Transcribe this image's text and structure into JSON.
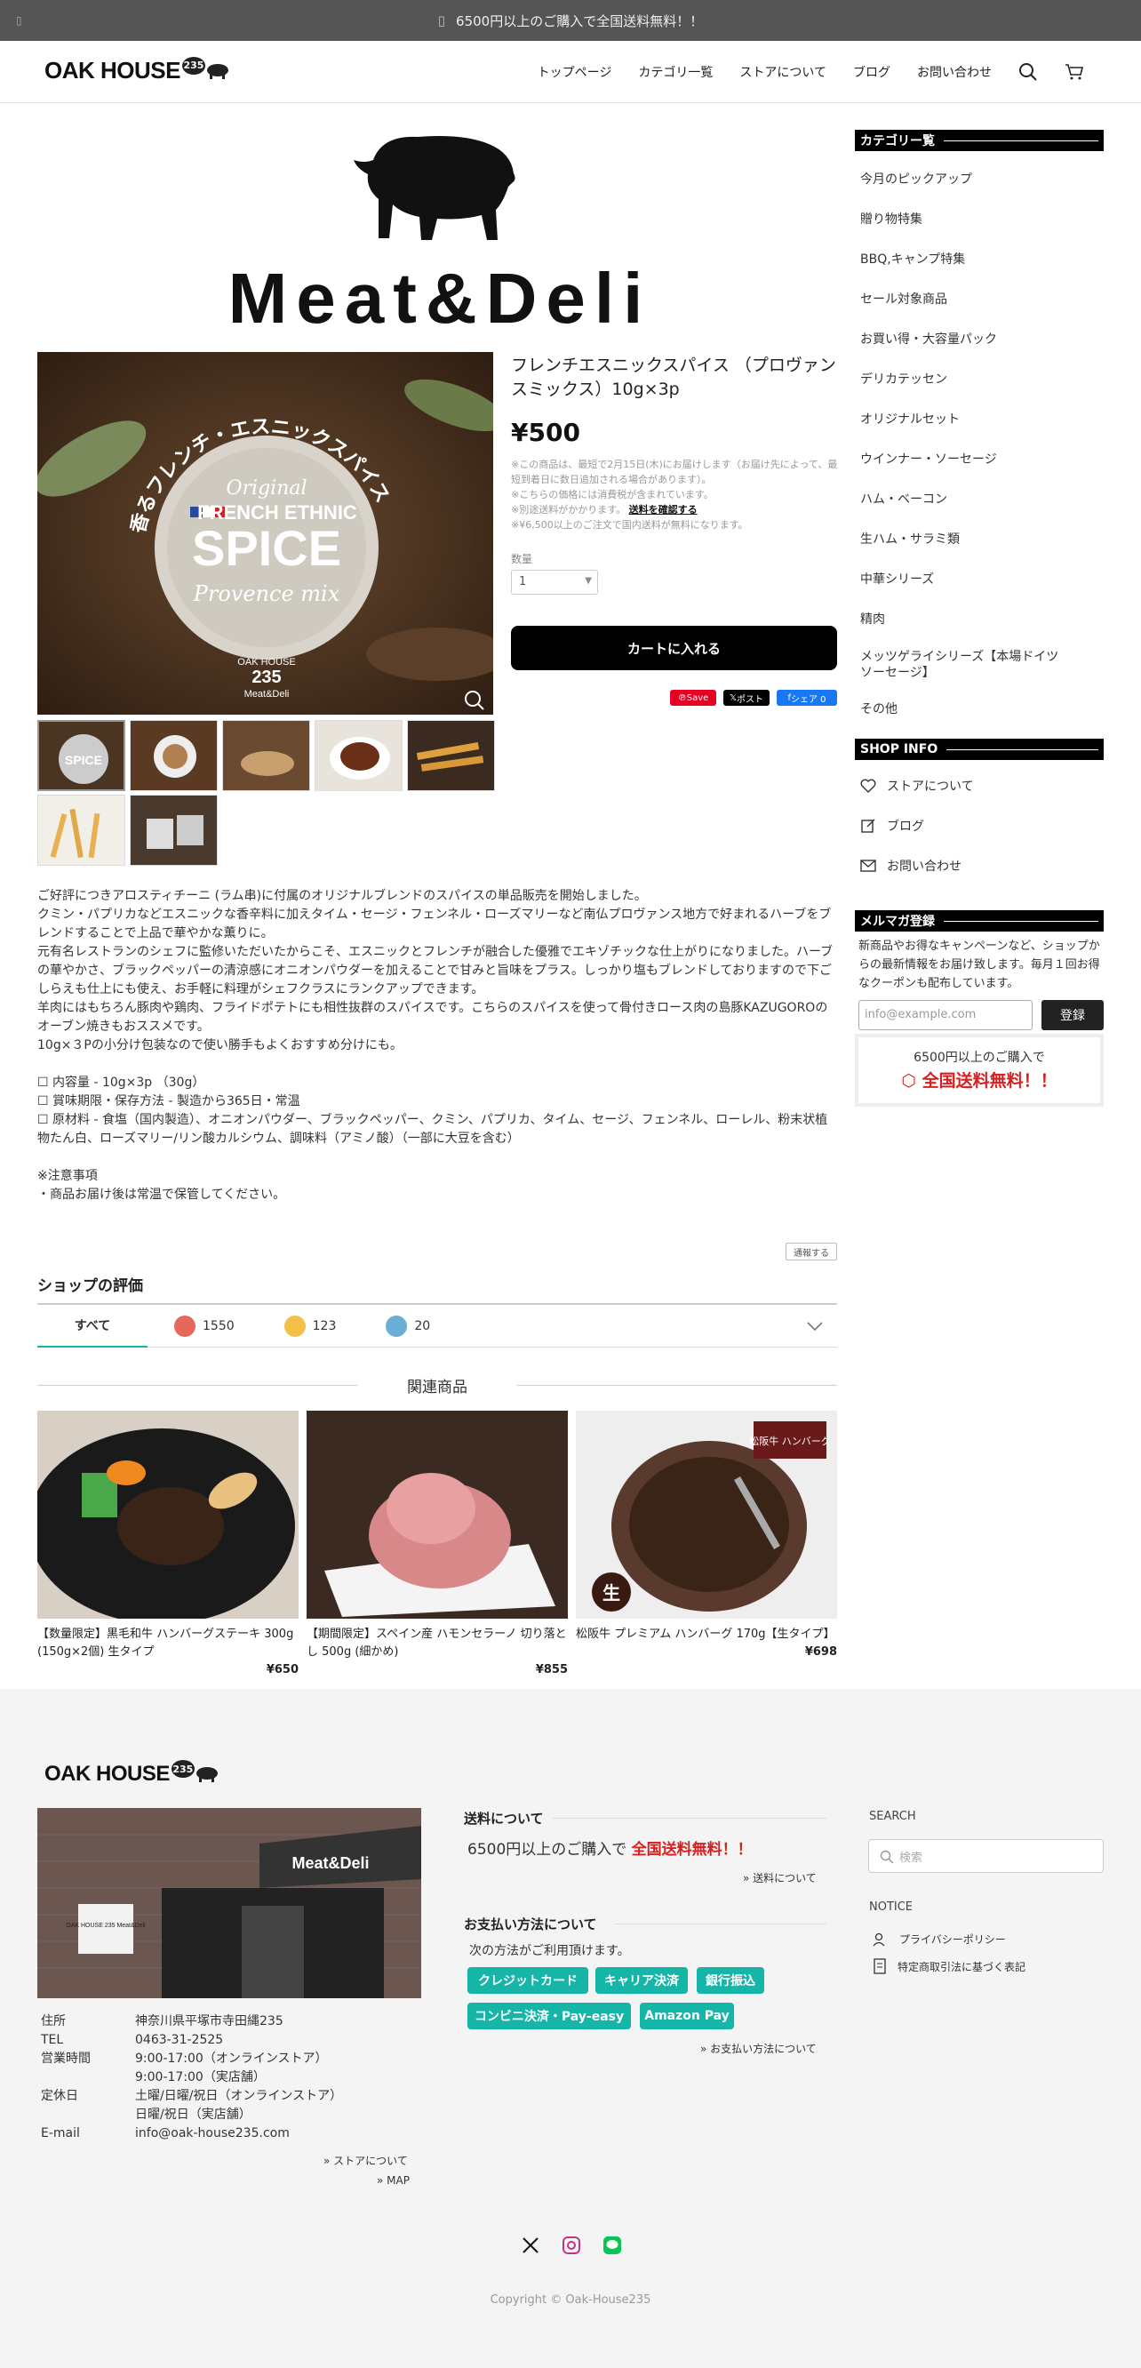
{
  "announcement": "6500円以上のご購入で全国送料無料！！",
  "brand": {
    "name": "OAK HOUSE",
    "badge": "235"
  },
  "nav": [
    "トップページ",
    "カテゴリ一覧",
    "ストアについて",
    "ブログ",
    "お問い合わせ"
  ],
  "hero_logo": "Meat&Deli",
  "product": {
    "title": "フレンチエスニックスパイス （プロヴァンスミックス）10g×3p",
    "price": "¥500",
    "notes": [
      "※この商品は、最短で2月15日(木)にお届けします（お届け先によって、最短到着日に数日追加される場合があります）。",
      "※こちらの価格には消費税が含まれています。",
      "※別途送料がかかります。",
      "※¥6,500以上のご注文で国内送料が無料になります。"
    ],
    "shipping_link": "送料を確認する",
    "qty_label": "数量",
    "qty_value": "1",
    "cart_button": "カートに入れる",
    "image_text": {
      "arc": "香るフレンチ・エスニックスパイス",
      "original": "Original",
      "fe": "FRENCH ETHNIC",
      "spice": "SPICE",
      "provence": "Provence mix",
      "oak": "OAK HOUSE",
      "num": "235",
      "md": "Meat&Deli"
    },
    "social": {
      "save": "Save",
      "x": "ポスト",
      "fb": "シェア 0"
    }
  },
  "description": [
    "ご好評につきアロスティチーニ (ラム串)に付属のオリジナルブレンドのスパイスの単品販売を開始しました。",
    "クミン・パプリカなどエスニックな香辛料に加えタイム・セージ・フェンネル・ローズマリーなど南仏プロヴァンス地方で好まれるハーブをブレンドすることで上品で華やかな薫りに。",
    "元有名レストランのシェフに監修いただいたからこそ、エスニックとフレンチが融合した優雅でエキゾチックな仕上がりになりました。ハーブの華やかさ、ブラックペッパーの清涼感にオニオンパウダーを加えることで甘みと旨味をプラス。しっかり塩もブレンドしておりますので下ごしらえも仕上にも使え、お手軽に料理がシェフクラスにランクアップできます。",
    "羊肉にはもちろん豚肉や鶏肉、フライドポテトにも相性抜群のスパイスです。こちらのスパイスを使って骨付きロース肉の島豚KAZUGOROのオーブン焼きもおススメです。",
    "10g×３Pの小分け包装なので使い勝手もよくおすすめ分けにも。",
    "",
    "☐ 内容量 - 10g×3p （30g）",
    "☐ 賞味期限・保存方法 - 製造から365日・常温",
    "☐ 原材料 - 食塩（国内製造）、オニオンパウダー、ブラックペッパー、クミン、パプリカ、タイム、セージ、フェンネル、ローレル、粉末状植物たん白、ローズマリー/リン酸カルシウム、調味料（アミノ酸）（一部に大豆を含む）",
    "",
    "※注意事項",
    "・商品お届け後は常温で保管してください。"
  ],
  "report": "通報する",
  "shop_eval": {
    "title": "ショップの評価",
    "all": "すべて",
    "good": "1550",
    "neutral": "123",
    "bad": "20"
  },
  "related": {
    "title": "関連商品",
    "items": [
      {
        "name": "【数量限定】黒毛和牛 ハンバーグステーキ 300g (150g×2個) 生タイプ",
        "price": "¥650"
      },
      {
        "name": "【期間限定】スペイン産 ハモンセラーノ 切り落とし 500g (細かめ)",
        "price": "¥855"
      },
      {
        "name": "松阪牛 プレミアム ハンバーグ 170g【生タイプ】",
        "price": "¥698",
        "badge": "松阪牛 ハンバーグ",
        "raw": "生"
      }
    ]
  },
  "sidebar": {
    "cat_title": "カテゴリー覧",
    "categories": [
      "今月のピックアップ",
      "贈り物特集",
      "BBQ,キャンプ特集",
      "セール対象商品",
      "お買い得・大容量パック",
      "デリカテッセン",
      "オリジナルセット",
      "ウインナー・ソーセージ",
      "ハム・ベーコン",
      "生ハム・サラミ類",
      "中華シリーズ",
      "精肉",
      "メッツゲライシリーズ【本場ドイツソーセージ】",
      "その他"
    ],
    "shop_title": "SHOP INFO",
    "shop_links": [
      "ストアについて",
      "ブログ",
      "お問い合わせ"
    ],
    "mm_title": "メルマガ登録",
    "mm_text": "新商品やお得なキャンペーンなど、ショップからの最新情報をお届け致します。毎月１回お得なクーポンも配布しています。",
    "mm_placeholder": "info@example.com",
    "mm_button": "登録",
    "ship_line1": "6500円以上のご購入で",
    "ship_line2": "全国送料無料！！"
  },
  "footer": {
    "store_photo_sign": "Meat&Deli",
    "store_photo_board": "OAK HOUSE 235 Meat&Deli",
    "info": [
      {
        "k": "住所",
        "v": "神奈川県平塚市寺田縄235"
      },
      {
        "k": "TEL",
        "v": "0463-31-2525"
      },
      {
        "k": "営業時間",
        "v": "9:00-17:00（オンラインストア）"
      },
      {
        "k": "",
        "v": "9:00-17:00（実店舗）"
      },
      {
        "k": "定休日",
        "v": "土曜/日曜/祝日（オンラインストア）"
      },
      {
        "k": "",
        "v": "日曜/祝日（実店舗）"
      },
      {
        "k": "E-mail",
        "v": "info@oak-house235.com"
      }
    ],
    "store_link": "ストアについて",
    "map_link": "MAP",
    "ship_title": "送料について",
    "ship_prefix": "6500円以上のご購入で",
    "ship_free": "全国送料無料！！",
    "ship_link": "送料について",
    "pay_title": "お支払い方法について",
    "pay_text": "次の方法がご利用頂けます。",
    "pay_methods": [
      "クレジットカード",
      "キャリア決済",
      "銀行振込",
      "コンビニ決済・Pay-easy",
      "Amazon Pay"
    ],
    "pay_link": "お支払い方法について",
    "search_title": "SEARCH",
    "search_placeholder": "検索",
    "notice_title": "NOTICE",
    "notice_links": [
      "プライバシーポリシー",
      "特定商取引法に基づく表記"
    ],
    "copyright": "Copyright © Oak-House235"
  },
  "colors": {
    "accent_red": "#d62020",
    "teal": "#15b5a8",
    "black": "#000000",
    "topbar": "#555555"
  }
}
